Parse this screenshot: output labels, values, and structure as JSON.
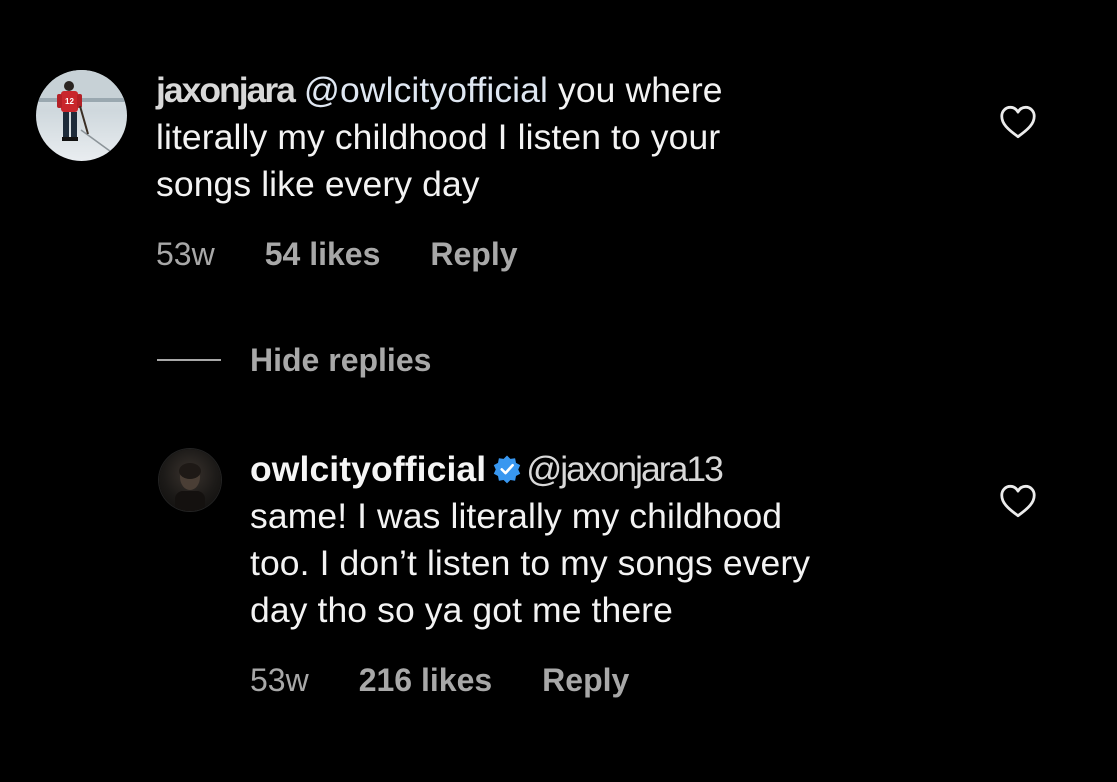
{
  "comment": {
    "username": "jaxonjara",
    "mention": "@owlcityofficial",
    "text_line1": " you where",
    "text_line2": "literally my childhood I listen to your",
    "text_line3": "songs like every day",
    "time": "53w",
    "likes": "54 likes",
    "reply_label": "Reply"
  },
  "hide_replies_label": "Hide replies",
  "reply": {
    "username": "owlcityofficial",
    "mention": "@jaxonjara13",
    "text_line1": "same! I was literally my childhood",
    "text_line2": "too. I don’t listen to my songs every",
    "text_line3": "day tho so ya got me there",
    "time": "53w",
    "likes": "216 likes",
    "reply_label": "Reply"
  },
  "colors": {
    "background": "#000000",
    "text": "#f3f3f3",
    "secondary": "#a8a8a8",
    "verified": "#3897f0",
    "jersey": "#c9262c"
  },
  "icons": {
    "like": "heart-outline-icon",
    "verified": "verified-badge-icon"
  }
}
